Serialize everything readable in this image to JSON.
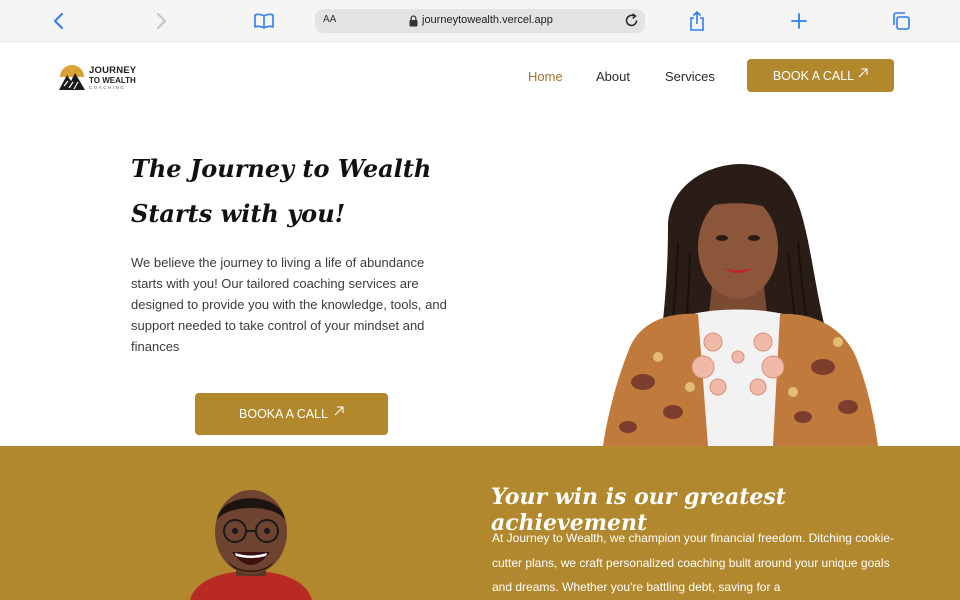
{
  "browser": {
    "reader_label": "AA",
    "url": "journeytowealth.vercel.app",
    "icons": [
      "back-icon",
      "forward-icon",
      "bookmarks-icon",
      "lock-icon",
      "reload-icon",
      "share-icon",
      "new-tab-icon",
      "tabs-icon"
    ],
    "accent_color": "#2f7cf6"
  },
  "logo": {
    "line1": "JOURNEY",
    "line2": "TO WEALTH",
    "line3": "COACHING"
  },
  "nav": {
    "items": [
      {
        "label": "Home",
        "active": true
      },
      {
        "label": "About",
        "active": false
      },
      {
        "label": "Services",
        "active": false
      }
    ],
    "cta_label": "BOOK A CALL"
  },
  "hero": {
    "title_line1": "The Journey to Wealth",
    "title_line2": "Starts with you!",
    "body": "We believe the journey to living a life of abundance starts with you! Our tailored coaching services are designed to provide you with the knowledge, tools, and support needed to take control of your mindset and finances",
    "cta_label": "BOOKA A CALL"
  },
  "win_section": {
    "title": "Your win is our greatest achievement",
    "body": "At Journey to Wealth, we champion your financial freedom. Ditching cookie-cutter plans, we craft personalized coaching built around your unique goals and dreams. Whether you're battling debt, saving for a"
  },
  "colors": {
    "brand_gold": "#b1882c",
    "active_nav": "#a5722f",
    "text_dark": "#111111"
  }
}
